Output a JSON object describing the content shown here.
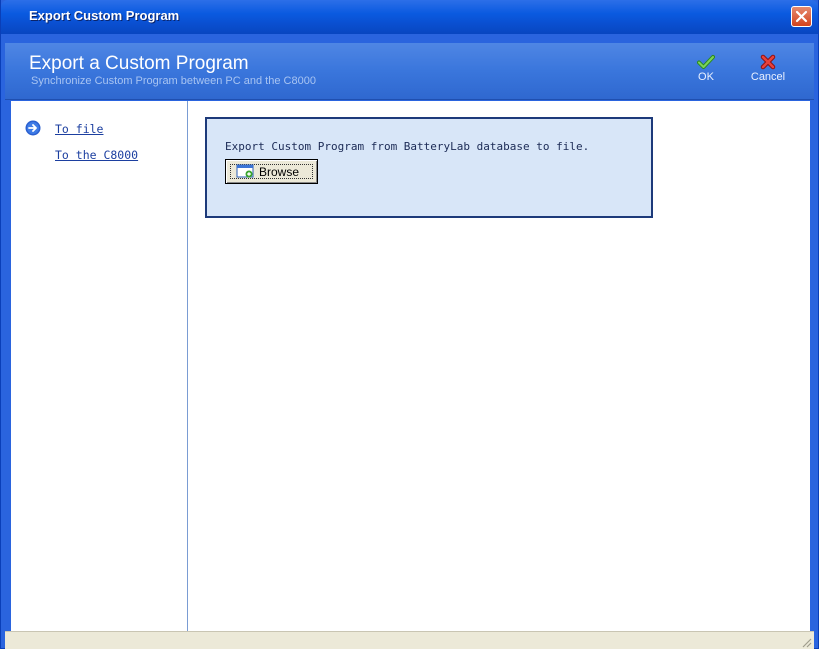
{
  "window": {
    "title": "Export Custom Program"
  },
  "header": {
    "title": "Export a Custom Program",
    "subtitle": "Synchronize Custom Program between PC and the C8000"
  },
  "toolbar": {
    "ok_label": "OK",
    "cancel_label": "Cancel"
  },
  "sidebar": {
    "items": [
      {
        "label": "To file",
        "icon": "arrow-right-circle-icon",
        "selected": true
      },
      {
        "label": "To the C8000",
        "selected": false
      }
    ]
  },
  "main": {
    "message": "Export Custom Program from BatteryLab database to file.",
    "browse_label": "Browse"
  },
  "colors": {
    "title_bar": "#0a4fd0",
    "header": "#3a76dc",
    "panel_background": "#d8e6f8",
    "panel_border": "#1d3a7a",
    "link": "#1c3fa0",
    "close_button": "#d3431d"
  }
}
